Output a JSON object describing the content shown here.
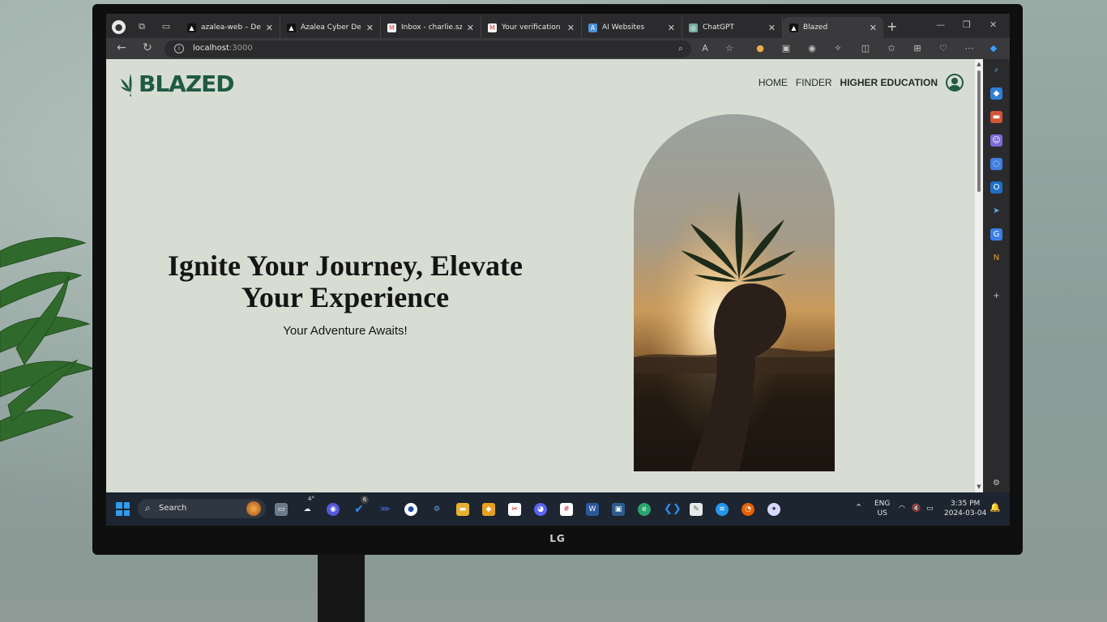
{
  "tabs": [
    {
      "title": "azalea-web – Deplo",
      "icon": "vercel-icon",
      "active": false
    },
    {
      "title": "Azalea Cyber Devel",
      "icon": "vercel-icon",
      "active": false
    },
    {
      "title": "Inbox - charlie.szafr",
      "icon": "gmail-icon",
      "active": false
    },
    {
      "title": "Your verification co",
      "icon": "gmail-icon",
      "active": false
    },
    {
      "title": "AI Websites",
      "icon": "ai-websites-icon",
      "active": false
    },
    {
      "title": "ChatGPT",
      "icon": "chatgpt-icon",
      "active": false
    },
    {
      "title": "Blazed",
      "icon": "vercel-icon",
      "active": true
    }
  ],
  "address": {
    "host": "localhost",
    "port": ":3000"
  },
  "site": {
    "logo_text": "BLAZED",
    "nav": [
      {
        "label": "HOME"
      },
      {
        "label": "FINDER"
      },
      {
        "label": "HIGHER EDUCATION"
      }
    ],
    "hero_title": "Ignite Your Journey, Elevate Your Experience",
    "hero_subtitle": "Your Adventure Awaits!"
  },
  "taskbar": {
    "search_label": "Search",
    "weather": "4°",
    "badge_count": "6",
    "lang_line1": "ENG",
    "lang_line2": "US",
    "time": "3:35 PM",
    "date": "2024-03-04"
  },
  "monitor_brand": "LG",
  "colors": {
    "brand_green": "#1f5a44",
    "page_bg": "#d8ddd3"
  }
}
